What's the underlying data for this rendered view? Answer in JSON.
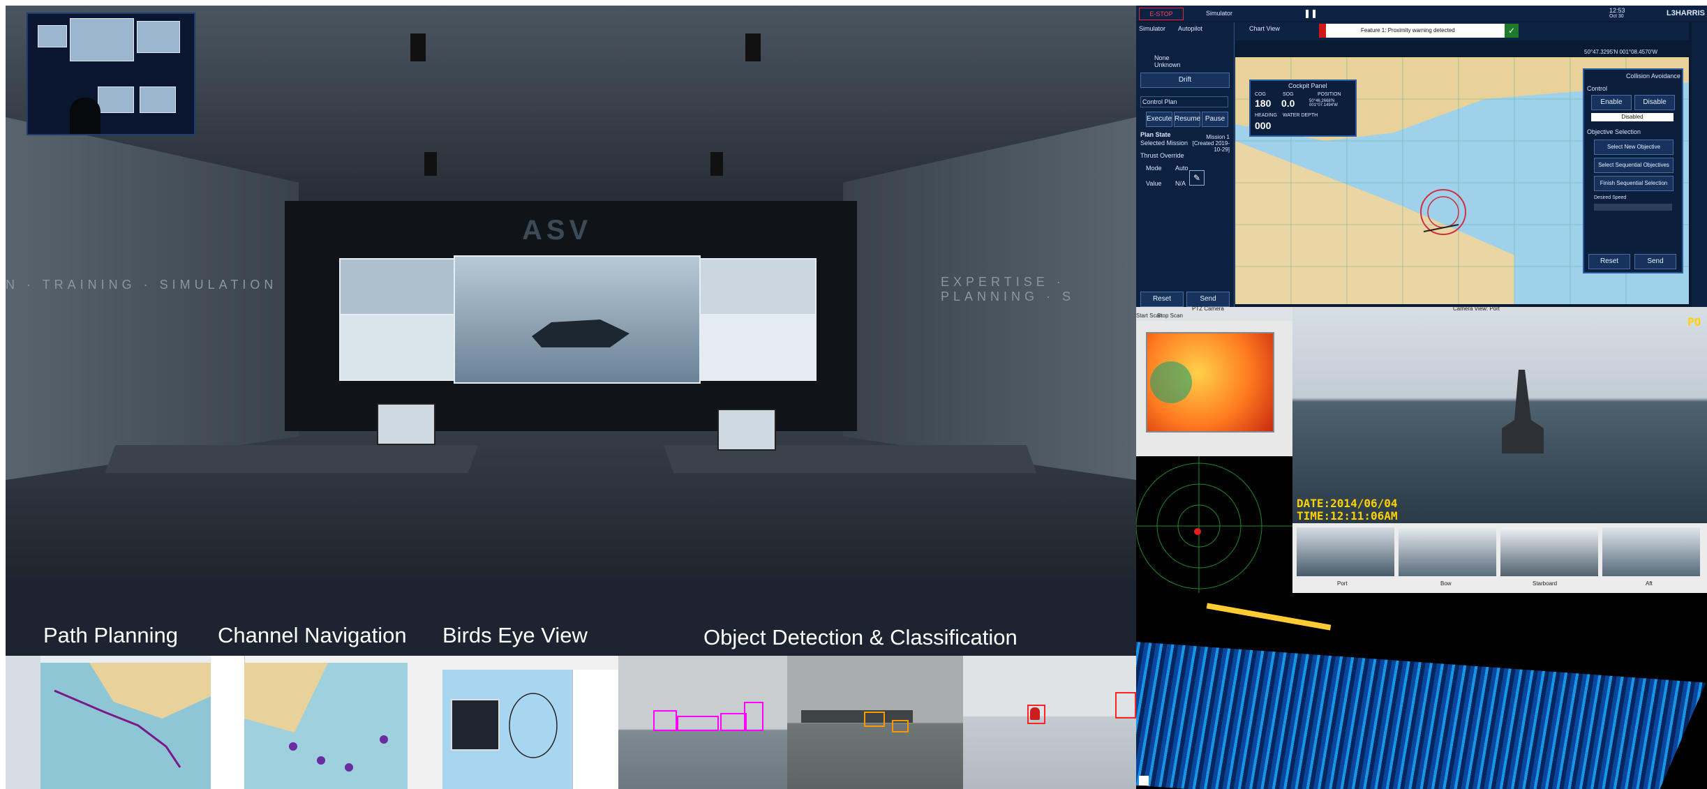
{
  "captions": {
    "path_planning": "Path Planning",
    "channel_navigation": "Channel Navigation",
    "birds_eye_view": "Birds Eye View",
    "object_detection": "Object Detection & Classification"
  },
  "hero": {
    "wall_left": "N · TRAINING · SIMULATION",
    "wall_right": "EXPERTISE · PLANNING · S",
    "back_logo": "ASV"
  },
  "control_ui": {
    "estop": "E-STOP",
    "mode": "Simulator",
    "clock_time": "12:53",
    "clock_date": "Oct 30",
    "brand": "L3HARRIS",
    "autopilot_tab": "Autopilot",
    "simulator_tab": "Simulator",
    "none_label": "None",
    "unknown_label": "Unknown",
    "drift_btn": "Drift",
    "control_plan": "Control Plan",
    "execute_btn": "Execute",
    "resume_btn": "Resume",
    "pause_btn": "Pause",
    "plan_state": "Plan State",
    "selected_mission_label": "Selected Mission",
    "selected_mission_value": "Mission 1 [Created 2019-10-29]",
    "thrust_override": "Thrust Override",
    "mode_label": "Mode",
    "mode_value": "Auto",
    "value_label": "Value",
    "value_value": "N/A",
    "reset_btn": "Reset",
    "send_btn": "Send",
    "chart_view_tab": "Chart View",
    "alert_text": "Feature 1: Proximity warning detected",
    "coords": "50°47.3295'N 001°08.4570'W",
    "cockpit_panel": "Cockpit Panel",
    "cog_label": "COG",
    "cog_value": "180",
    "sog_label": "SOG",
    "sog_value": "0.0",
    "position_label": "POSITION",
    "position_value": "50°46.2668'N 001°07.1494'W",
    "heading_label": "HEADING",
    "heading_value": "000",
    "water_depth_label": "WATER DEPTH",
    "collision_tab": "Collision Avoidance",
    "control_label": "Control",
    "enable_btn": "Enable",
    "disable_btn": "Disable",
    "disabled_state": "Disabled",
    "objective_selection": "Objective Selection",
    "select_new_objective": "Select New Objective",
    "select_sequential": "Select Sequential Objectives",
    "finish_sequential": "Finish Sequential Selection",
    "desired_speed": "Desired Speed",
    "reset2_btn": "Reset",
    "send2_btn": "Send"
  },
  "camera_ui": {
    "ptz_title": "PTZ Camera",
    "start_scan": "Start Scan",
    "stop_scan": "Stop Scan",
    "color_title": "Camera View: Port",
    "date_overlay": "DATE:2014/06/04",
    "time_overlay": "TIME:12:11:06AM",
    "corner_label": "PO",
    "thumb_port": "Port",
    "thumb_bow": "Bow",
    "thumb_starboard": "Starboard",
    "thumb_aft": "Aft"
  },
  "colors": {
    "caption_band": "#1b2430",
    "ui_navy": "#0a1a33",
    "detection_magenta": "#ff00ff",
    "detection_orange": "#ff9900",
    "detection_red": "#ff2222",
    "lidar_blue": "#1aa6ff"
  }
}
